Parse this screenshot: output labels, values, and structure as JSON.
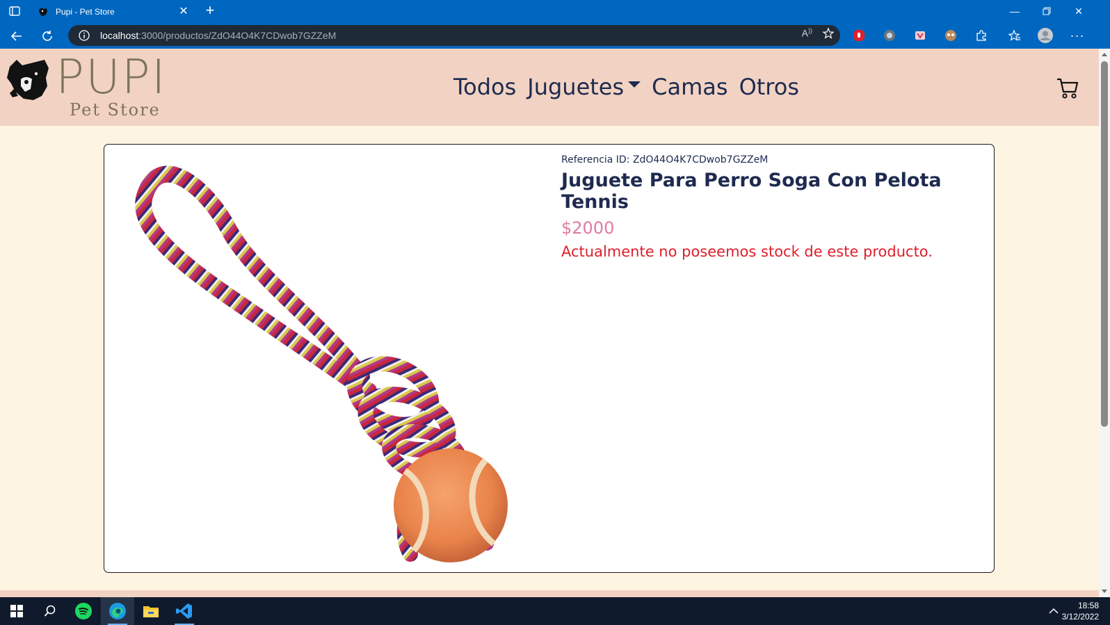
{
  "browser": {
    "tab_title": "Pupi - Pet Store",
    "url_host": "localhost",
    "url_path": ":3000/productos/ZdO44O4K7CDwob7GZZeM"
  },
  "site": {
    "logo_word": "PUPI",
    "logo_subtitle": "Pet Store",
    "nav": {
      "todos": "Todos",
      "juguetes": "Juguetes",
      "camas": "Camas",
      "otros": "Otros"
    }
  },
  "product": {
    "reference": "Referencia ID: ZdO44O4K7CDwob7GZZeM",
    "title": "Juguete Para Perro Soga Con Pelota Tennis",
    "price": "$2000",
    "stock_message": "Actualmente no poseemos stock de este producto."
  },
  "taskbar": {
    "time": "18:58",
    "date": "3/12/2022"
  },
  "colors": {
    "header_bg": "#f2d3c3",
    "page_bg": "#fdf4e2",
    "nav_text": "#1e2a4f",
    "price": "#e07aa3",
    "stock_warning": "#dc1f2c",
    "browser_chrome": "#0067c0"
  }
}
